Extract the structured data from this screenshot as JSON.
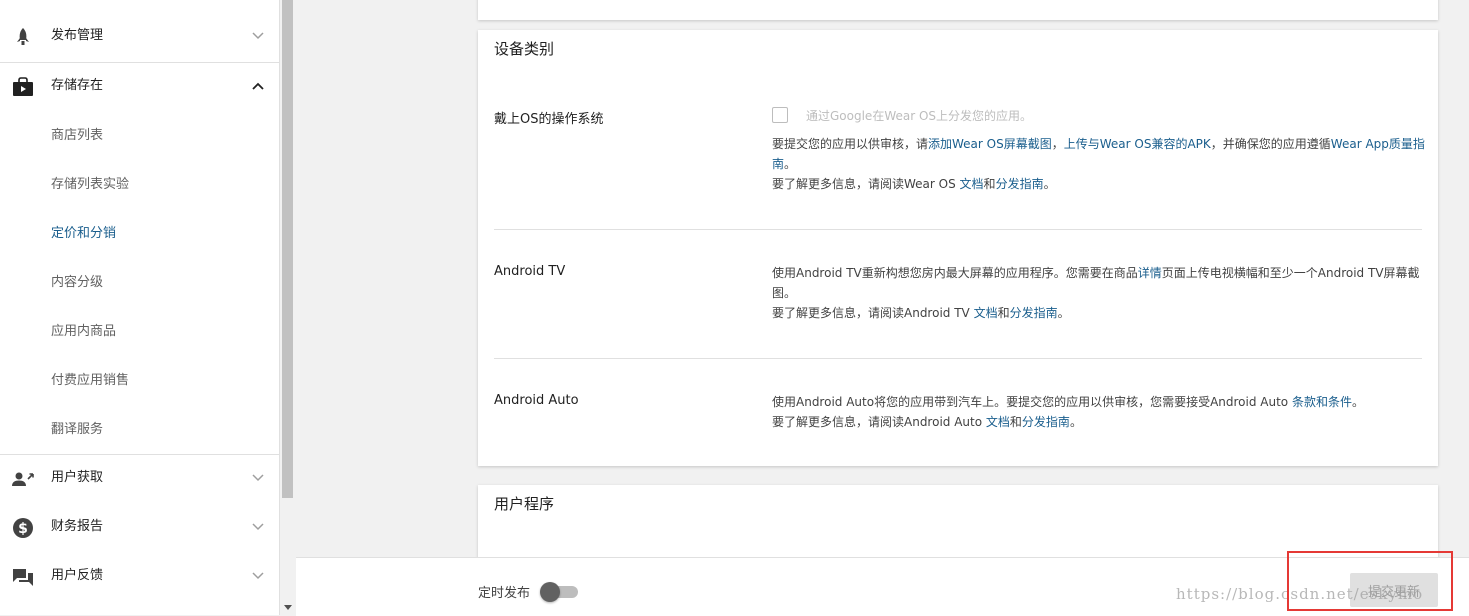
{
  "sidebar": {
    "items": [
      {
        "label": "发布管理",
        "icon": "rocket-icon",
        "expanded": false
      },
      {
        "label": "存储存在",
        "icon": "store-bag-icon",
        "expanded": true
      },
      {
        "label": "用户获取",
        "icon": "user-add-icon",
        "expanded": false
      },
      {
        "label": "财务报告",
        "icon": "dollar-icon",
        "expanded": false
      },
      {
        "label": "用户反馈",
        "icon": "chat-icon",
        "expanded": false
      }
    ],
    "subitems": [
      "商店列表",
      "存储列表实验",
      "定价和分销",
      "内容分级",
      "应用内商品",
      "付费应用销售",
      "翻译服务"
    ],
    "active_subitem": "定价和分销"
  },
  "device_card": {
    "title": "设备类别",
    "wear": {
      "label": "戴上OS的操作系统",
      "checkbox_label": "通过Google在Wear OS上分发您的应用。",
      "checked": false,
      "d1": "要提交您的应用以供审核，请",
      "l1": "添加Wear OS屏幕截图",
      "d2": "，",
      "l2": "上传与Wear OS兼容的APK",
      "d3": "，并确保您的应用遵循",
      "l3": "Wear App质量",
      "l4": "指南",
      "d4": "。",
      "m1": "要了解更多信息，请阅读Wear OS ",
      "ml1": "文档",
      "m2": "和",
      "ml2": "分发指南",
      "m3": "。"
    },
    "tv": {
      "label": "Android TV",
      "d1": "使用Android TV重新构想您房内最大屏幕的应用程序。您需要在商品",
      "l1": "详情",
      "d2": "页面上传电视横幅和至少一个Android TV屏幕截图。",
      "m1": "要了解更多信息，请阅读Android TV ",
      "ml1": "文档",
      "m2": "和",
      "ml2": "分发指南",
      "m3": "。"
    },
    "auto": {
      "label": "Android Auto",
      "d1": "使用Android Auto将您的应用带到汽车上。要提交您的应用以供审核，您需要接受Android Auto ",
      "l1": "条款和条件",
      "d2": "。",
      "m1": "要了解更多信息，请阅读Android Auto ",
      "ml1": "文档",
      "m2": "和",
      "ml2": "分发指南",
      "m3": "。"
    }
  },
  "user_program_card": {
    "title": "用户程序"
  },
  "bottom_bar": {
    "schedule_label": "定时发布",
    "schedule_on": false,
    "submit_label": "提交更新"
  },
  "watermark": "https://blog.csdn.net/eskymo",
  "colors": {
    "link": "#1a5e8d",
    "highlight_box": "#e53935"
  }
}
